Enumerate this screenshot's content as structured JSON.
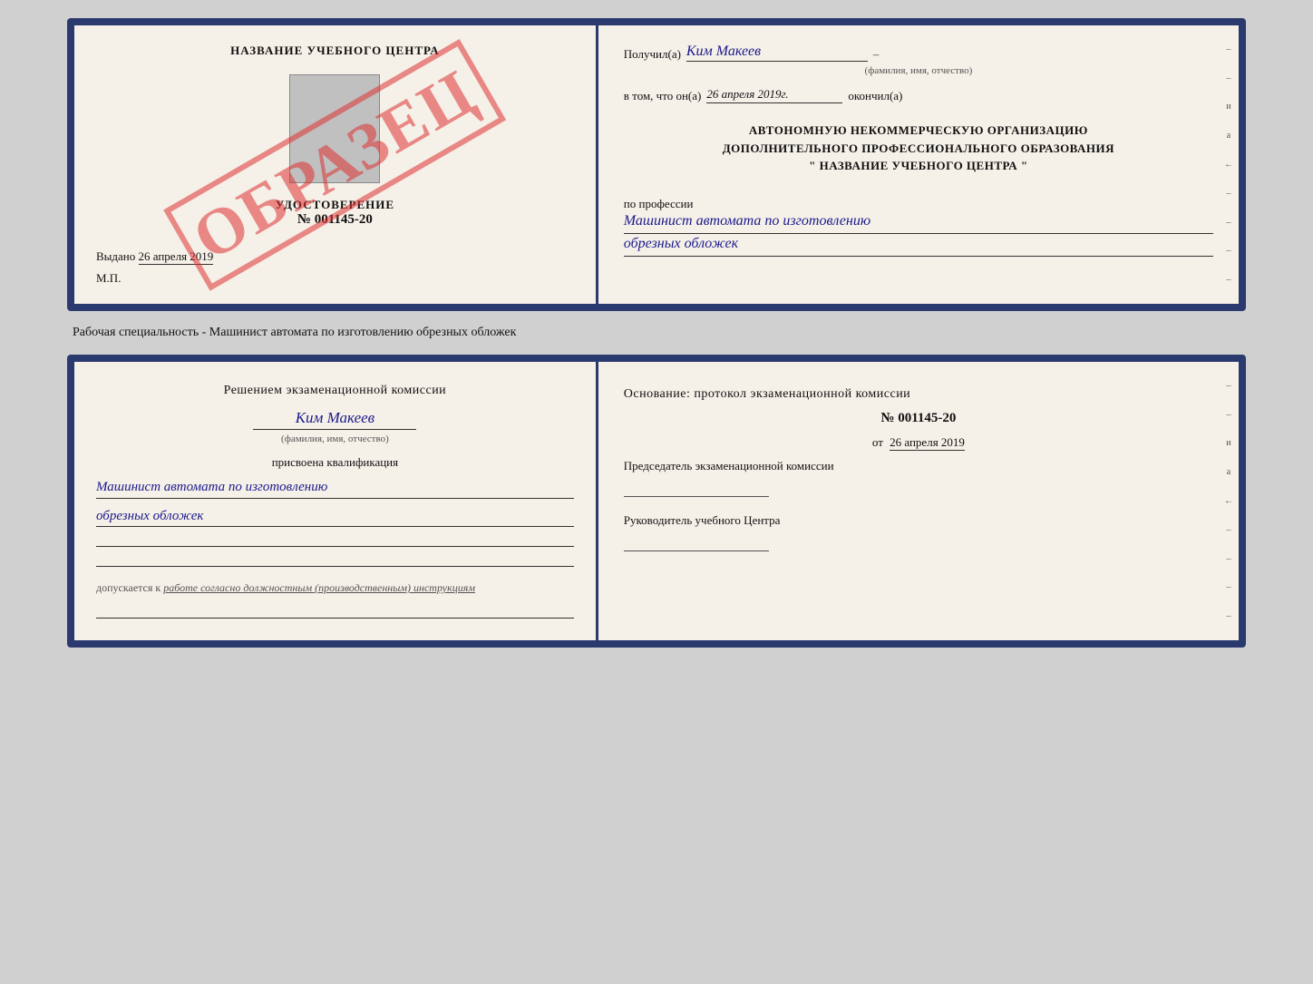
{
  "top_cert": {
    "left": {
      "title": "НАЗВАНИЕ УЧЕБНОГО ЦЕНТРА",
      "cert_label": "УДОСТОВЕРЕНИЕ",
      "cert_number": "№ 001145-20",
      "date_label": "Выдано",
      "date_value": "26 апреля 2019",
      "mp_label": "М.П.",
      "watermark": "ОБРАЗЕЦ"
    },
    "right": {
      "received_label": "Получил(а)",
      "received_value": "Ким Макеев",
      "received_subtitle": "(фамилия, имя, отчество)",
      "dash1": "–",
      "date_prefix": "в том, что он(а)",
      "date_value": "26 апреля 2019г.",
      "completed_label": "окончил(а)",
      "org_line1": "АВТОНОМНУЮ НЕКОММЕРЧЕСКУЮ ОРГАНИЗАЦИЮ",
      "org_line2": "ДОПОЛНИТЕЛЬНОГО ПРОФЕССИОНАЛЬНОГО ОБРАЗОВАНИЯ",
      "org_line3": "\"  НАЗВАНИЕ УЧЕБНОГО ЦЕНТРА  \"",
      "profession_label": "по профессии",
      "profession_value1": "Машинист автомата по изготовлению",
      "profession_value2": "обрезных обложек",
      "side_marks": [
        "-",
        "-",
        "и",
        "а",
        "←",
        "-",
        "-",
        "-",
        "-"
      ]
    }
  },
  "caption": "Рабочая специальность - Машинист автомата по изготовлению обрезных обложек",
  "bottom_cert": {
    "left": {
      "decision_label": "Решением экзаменационной комиссии",
      "name_value": "Ким Макеев",
      "fio_subtitle": "(фамилия, имя, отчество)",
      "assigned_label": "присвоена квалификация",
      "qualification1": "Машинист автомата по изготовлению",
      "qualification2": "обрезных обложек",
      "допускается_prefix": "допускается к",
      "допускается_value": "работе согласно должностным (производственным) инструкциям"
    },
    "right": {
      "basis_label": "Основание: протокол экзаменационной комиссии",
      "protocol_number": "№ 001145-20",
      "date_prefix": "от",
      "date_value": "26 апреля 2019",
      "chairman_label": "Председатель экзаменационной комиссии",
      "director_label": "Руководитель учебного Центра",
      "side_marks": [
        "-",
        "-",
        "и",
        "а",
        "←",
        "-",
        "-",
        "-",
        "-"
      ]
    }
  }
}
